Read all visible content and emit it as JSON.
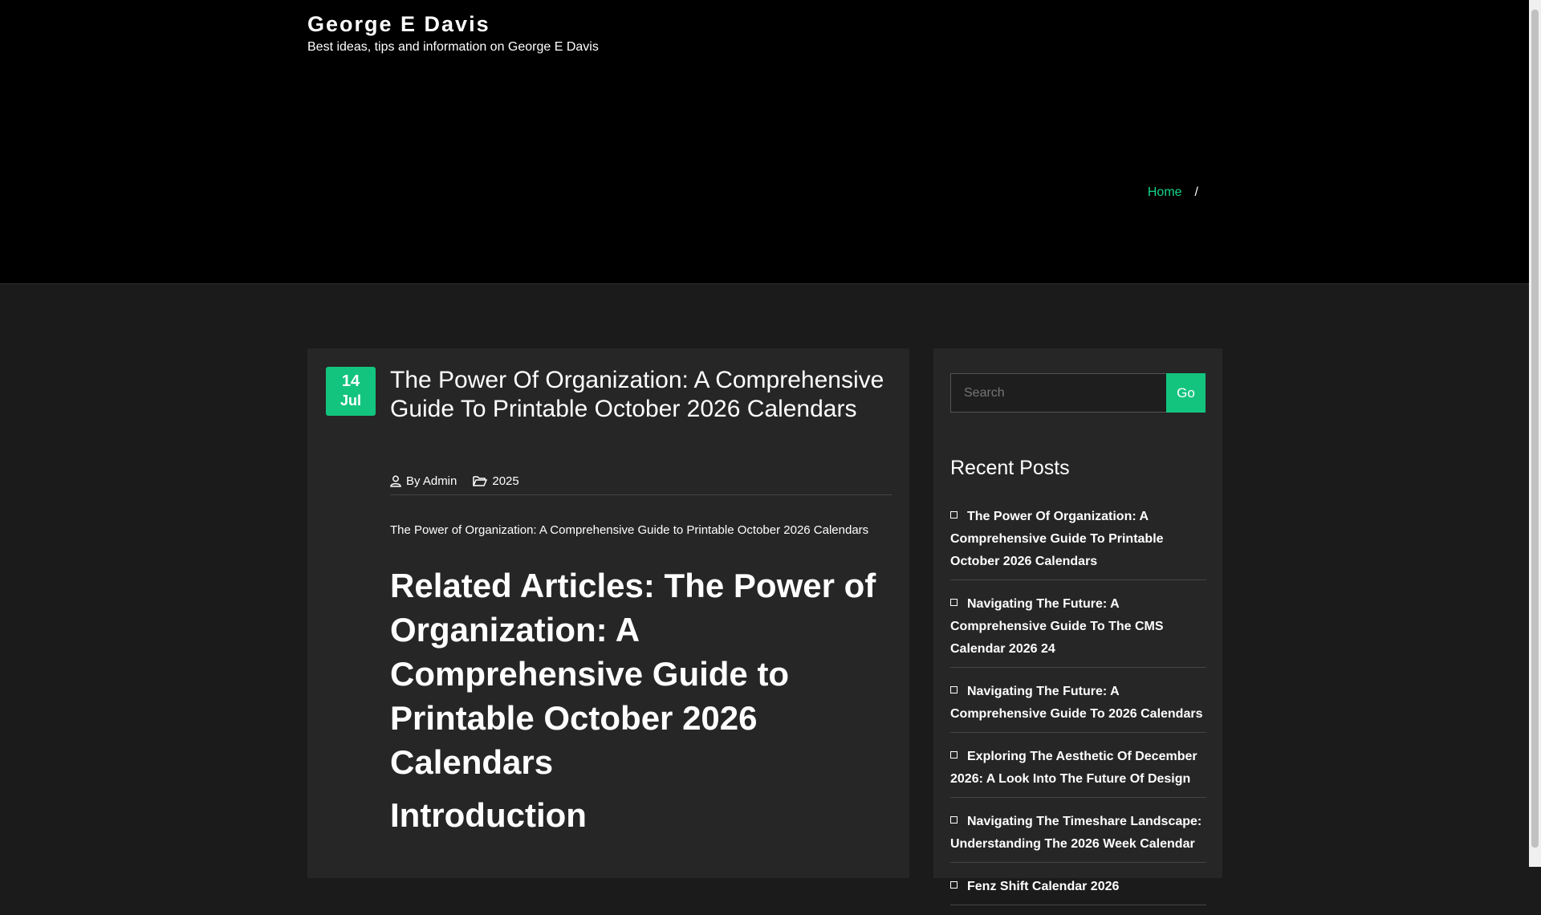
{
  "site": {
    "title": "George E Davis",
    "tagline": "Best ideas, tips and information on George E Davis"
  },
  "breadcrumb": {
    "home": "Home",
    "separator": "/"
  },
  "post": {
    "date_day": "14",
    "date_month": "Jul",
    "title": "The Power Of Organization: A Comprehensive Guide To Printable October 2026 Calendars",
    "author": "By Admin",
    "category": "2025",
    "intro_line": "The Power of Organization: A Comprehensive Guide to Printable October 2026 Calendars",
    "related_heading": "Related Articles: The Power of Organization: A Comprehensive Guide to Printable October 2026 Calendars",
    "intro_heading": "Introduction"
  },
  "sidebar": {
    "search_placeholder": "Search",
    "search_button": "Go",
    "recent_title": "Recent Posts",
    "recent_posts": [
      "The Power Of Organization: A Comprehensive Guide To Printable October 2026 Calendars",
      "Navigating The Future: A Comprehensive Guide To The CMS Calendar 2026 24",
      "Navigating The Future: A Comprehensive Guide To 2026 Calendars",
      "Exploring The Aesthetic Of December 2026: A Look Into The Future Of Design",
      "Navigating The Timeshare Landscape: Understanding The 2026 Week Calendar",
      "Fenz Shift Calendar 2026"
    ]
  },
  "colors": {
    "accent": "#13c47f",
    "link": "#16d48a",
    "background": "#1b1b1b",
    "header": "#000000",
    "card": "#262626"
  }
}
